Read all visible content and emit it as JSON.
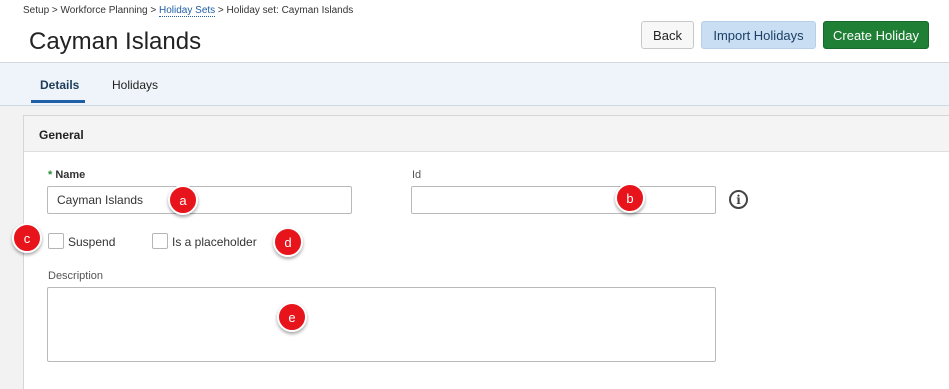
{
  "breadcrumb": {
    "part1": "Setup > Workforce Planning > ",
    "link": "Holiday Sets",
    "part2": " > Holiday set: Cayman Islands"
  },
  "page_title": "Cayman Islands",
  "header_buttons": {
    "back": "Back",
    "import": "Import Holidays",
    "create": "Create Holiday"
  },
  "tabs": [
    {
      "label": "Details",
      "active": true
    },
    {
      "label": "Holidays",
      "active": false
    }
  ],
  "section": {
    "title": "General"
  },
  "form": {
    "name_required_marker": "*",
    "name_label": "Name",
    "name_value": "Cayman Islands",
    "id_label": "Id",
    "id_value": "",
    "info_icon": "info-icon",
    "suspend_label": "Suspend",
    "suspend_checked": false,
    "placeholder_label": "Is a placeholder",
    "placeholder_checked": false,
    "description_label": "Description",
    "description_value": ""
  },
  "annotations": {
    "a": "a",
    "b": "b",
    "c": "c",
    "d": "d",
    "e": "e"
  },
  "colors": {
    "accent_link": "#1f5fa6",
    "create_button": "#1e7f35",
    "import_button": "#c9def2",
    "marker": "#e8141b"
  }
}
